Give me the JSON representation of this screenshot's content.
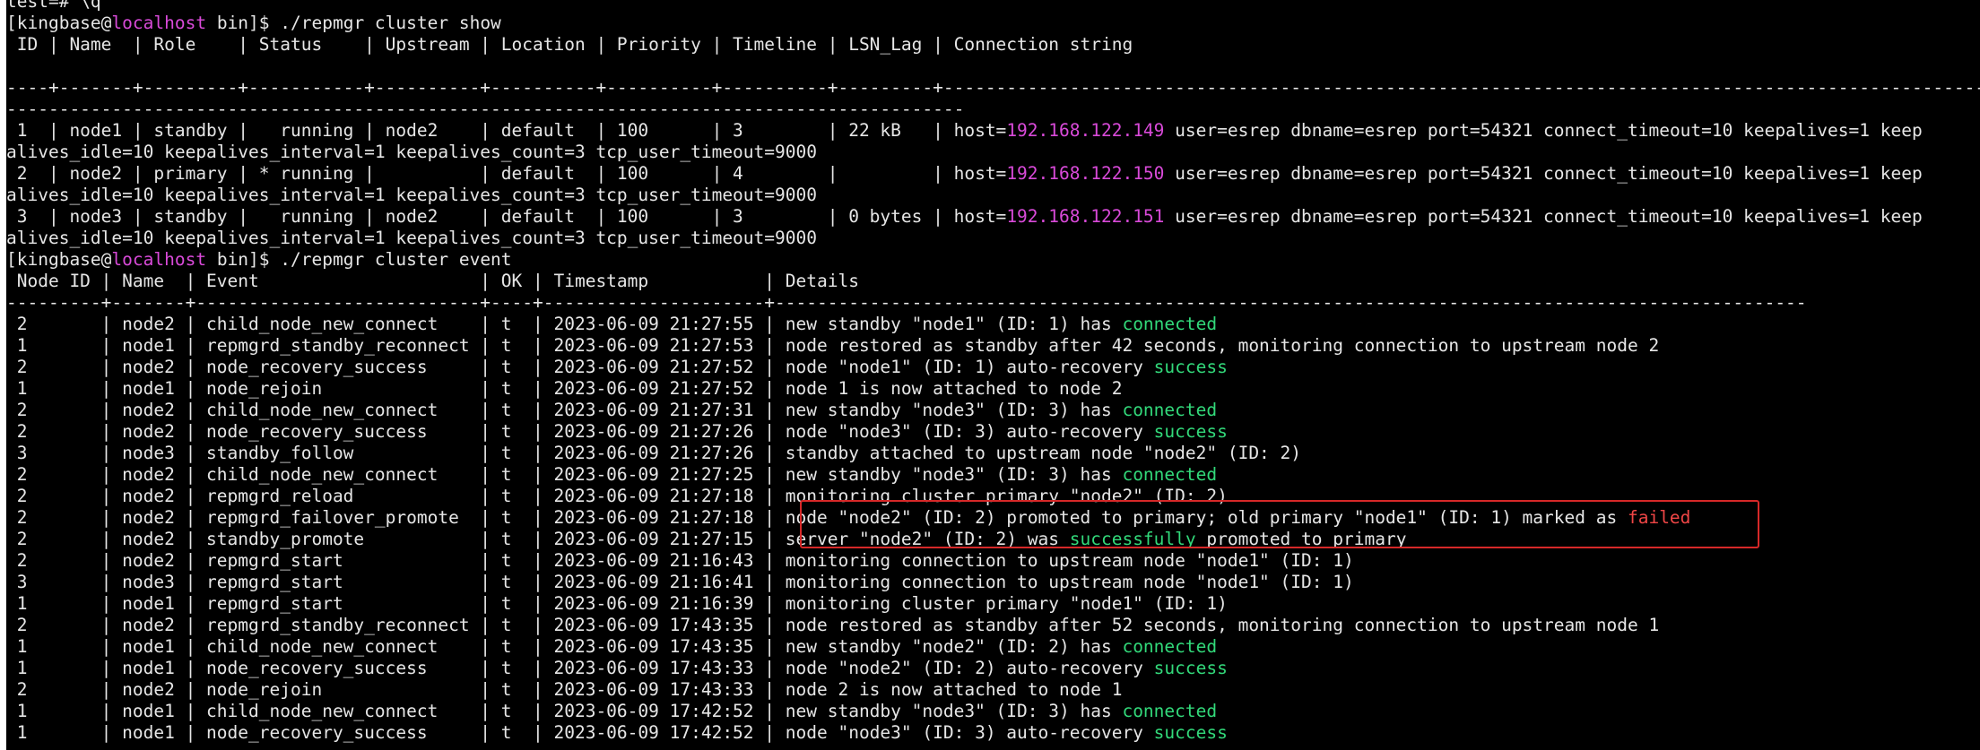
{
  "colors": {
    "background": "#000000",
    "text": "#e6e6e6",
    "prompt_host": "#d94ad9",
    "ip_address": "#d94ad9",
    "success": "#32d97a",
    "failed": "#f04646",
    "highlight_border": "#d62828"
  },
  "terminal": {
    "lines": [
      {
        "segs": [
          {
            "t": "test=# \\q",
            "c": "default"
          }
        ]
      },
      {
        "segs": [
          {
            "t": "[kingbase@",
            "c": "default"
          },
          {
            "t": "localhost",
            "c": "magenta"
          },
          {
            "t": " bin]$ ./repmgr cluster show",
            "c": "default"
          }
        ]
      },
      {
        "segs": [
          {
            "t": " ID | Name  | Role    | Status    | Upstream | Location | Priority | Timeline | LSN_Lag | Connection string",
            "c": "default"
          }
        ]
      },
      {
        "segs": [
          {
            "t": "",
            "c": "default"
          }
        ]
      },
      {
        "segs": [
          {
            "t": "----+-------+---------+-----------+----------+----------+----------+----------+---------+-----------------------------------------------------------------------------------------------------------------------------------",
            "c": "default"
          }
        ]
      },
      {
        "segs": [
          {
            "t": "-------------------------------------------------------------------------------------------",
            "c": "default"
          }
        ]
      },
      {
        "segs": [
          {
            "t": " 1  | node1 | standby |   running | node2    | default  | 100      | 3        | 22 kB   | host=",
            "c": "default"
          },
          {
            "t": "192.168.122.149",
            "c": "magenta"
          },
          {
            "t": " user=esrep dbname=esrep port=54321 connect_timeout=10 keepalives=1 keep",
            "c": "default"
          }
        ]
      },
      {
        "segs": [
          {
            "t": "alives_idle=10 keepalives_interval=1 keepalives_count=3 tcp_user_timeout=9000",
            "c": "default"
          }
        ]
      },
      {
        "segs": [
          {
            "t": " 2  | node2 | primary | * running |          | default  | 100      | 4        |         | host=",
            "c": "default"
          },
          {
            "t": "192.168.122.150",
            "c": "magenta"
          },
          {
            "t": " user=esrep dbname=esrep port=54321 connect_timeout=10 keepalives=1 keep",
            "c": "default"
          }
        ]
      },
      {
        "segs": [
          {
            "t": "alives_idle=10 keepalives_interval=1 keepalives_count=3 tcp_user_timeout=9000",
            "c": "default"
          }
        ]
      },
      {
        "segs": [
          {
            "t": " 3  | node3 | standby |   running | node2    | default  | 100      | 3        | 0 bytes | host=",
            "c": "default"
          },
          {
            "t": "192.168.122.151",
            "c": "magenta"
          },
          {
            "t": " user=esrep dbname=esrep port=54321 connect_timeout=10 keepalives=1 keep",
            "c": "default"
          }
        ]
      },
      {
        "segs": [
          {
            "t": "alives_idle=10 keepalives_interval=1 keepalives_count=3 tcp_user_timeout=9000",
            "c": "default"
          }
        ]
      },
      {
        "segs": [
          {
            "t": "[kingbase@",
            "c": "default"
          },
          {
            "t": "localhost",
            "c": "magenta"
          },
          {
            "t": " bin]$ ./repmgr cluster event",
            "c": "default"
          }
        ]
      },
      {
        "segs": [
          {
            "t": " Node ID | Name  | Event                     | OK | Timestamp           | Details",
            "c": "default"
          }
        ]
      },
      {
        "segs": [
          {
            "t": "---------+-------+---------------------------+----+---------------------+--------------------------------------------------------------------------------------------------",
            "c": "default"
          }
        ]
      },
      {
        "segs": [
          {
            "t": " 2       | node2 | child_node_new_connect    | t  | 2023-06-09 21:27:55 | new standby \"node1\" (ID: 1) has ",
            "c": "default"
          },
          {
            "t": "connected",
            "c": "green"
          }
        ]
      },
      {
        "segs": [
          {
            "t": " 1       | node1 | repmgrd_standby_reconnect | t  | 2023-06-09 21:27:53 | node restored as standby after 42 seconds, monitoring connection to upstream node 2",
            "c": "default"
          }
        ]
      },
      {
        "segs": [
          {
            "t": " 2       | node2 | node_recovery_success     | t  | 2023-06-09 21:27:52 | node \"node1\" (ID: 1) auto-recovery ",
            "c": "default"
          },
          {
            "t": "success",
            "c": "green"
          }
        ]
      },
      {
        "segs": [
          {
            "t": " 1       | node1 | node_rejoin               | t  | 2023-06-09 21:27:52 | node 1 is now attached to node 2",
            "c": "default"
          }
        ]
      },
      {
        "segs": [
          {
            "t": " 2       | node2 | child_node_new_connect    | t  | 2023-06-09 21:27:31 | new standby \"node3\" (ID: 3) has ",
            "c": "default"
          },
          {
            "t": "connected",
            "c": "green"
          }
        ]
      },
      {
        "segs": [
          {
            "t": " 2       | node2 | node_recovery_success     | t  | 2023-06-09 21:27:26 | node \"node3\" (ID: 3) auto-recovery ",
            "c": "default"
          },
          {
            "t": "success",
            "c": "green"
          }
        ]
      },
      {
        "segs": [
          {
            "t": " 3       | node3 | standby_follow            | t  | 2023-06-09 21:27:26 | standby attached to upstream node \"node2\" (ID: 2)",
            "c": "default"
          }
        ]
      },
      {
        "segs": [
          {
            "t": " 2       | node2 | child_node_new_connect    | t  | 2023-06-09 21:27:25 | new standby \"node3\" (ID: 3) has ",
            "c": "default"
          },
          {
            "t": "connected",
            "c": "green"
          }
        ]
      },
      {
        "segs": [
          {
            "t": " 2       | node2 | repmgrd_reload            | t  | 2023-06-09 21:27:18 | monitoring cluster primary \"node2\" (ID: 2)",
            "c": "default"
          }
        ]
      },
      {
        "segs": [
          {
            "t": " 2       | node2 | repmgrd_failover_promote  | t  | 2023-06-09 21:27:18 | node \"node2\" (ID: 2) promoted to primary; old primary \"node1\" (ID: 1) marked as ",
            "c": "default"
          },
          {
            "t": "failed",
            "c": "red"
          }
        ]
      },
      {
        "segs": [
          {
            "t": " 2       | node2 | standby_promote           | t  | 2023-06-09 21:27:15 | server \"node2\" (ID: 2) was ",
            "c": "default"
          },
          {
            "t": "successfully",
            "c": "green"
          },
          {
            "t": " promoted to primary",
            "c": "default"
          }
        ]
      },
      {
        "segs": [
          {
            "t": " 2       | node2 | repmgrd_start             | t  | 2023-06-09 21:16:43 | monitoring connection to upstream node \"node1\" (ID: 1)",
            "c": "default"
          }
        ]
      },
      {
        "segs": [
          {
            "t": " 3       | node3 | repmgrd_start             | t  | 2023-06-09 21:16:41 | monitoring connection to upstream node \"node1\" (ID: 1)",
            "c": "default"
          }
        ]
      },
      {
        "segs": [
          {
            "t": " 1       | node1 | repmgrd_start             | t  | 2023-06-09 21:16:39 | monitoring cluster primary \"node1\" (ID: 1)",
            "c": "default"
          }
        ]
      },
      {
        "segs": [
          {
            "t": " 2       | node2 | repmgrd_standby_reconnect | t  | 2023-06-09 17:43:35 | node restored as standby after 52 seconds, monitoring connection to upstream node 1",
            "c": "default"
          }
        ]
      },
      {
        "segs": [
          {
            "t": " 1       | node1 | child_node_new_connect    | t  | 2023-06-09 17:43:35 | new standby \"node2\" (ID: 2) has ",
            "c": "default"
          },
          {
            "t": "connected",
            "c": "green"
          }
        ]
      },
      {
        "segs": [
          {
            "t": " 1       | node1 | node_recovery_success     | t  | 2023-06-09 17:43:33 | node \"node2\" (ID: 2) auto-recovery ",
            "c": "default"
          },
          {
            "t": "success",
            "c": "green"
          }
        ]
      },
      {
        "segs": [
          {
            "t": " 2       | node2 | node_rejoin               | t  | 2023-06-09 17:43:33 | node 2 is now attached to node 1",
            "c": "default"
          }
        ]
      },
      {
        "segs": [
          {
            "t": " 1       | node1 | child_node_new_connect    | t  | 2023-06-09 17:42:52 | new standby \"node3\" (ID: 3) has ",
            "c": "default"
          },
          {
            "t": "connected",
            "c": "green"
          }
        ]
      },
      {
        "segs": [
          {
            "t": " 1       | node1 | node_recovery_success     | t  | 2023-06-09 17:42:52 | node \"node3\" (ID: 3) auto-recovery ",
            "c": "default"
          },
          {
            "t": "success",
            "c": "green"
          }
        ]
      }
    ]
  }
}
